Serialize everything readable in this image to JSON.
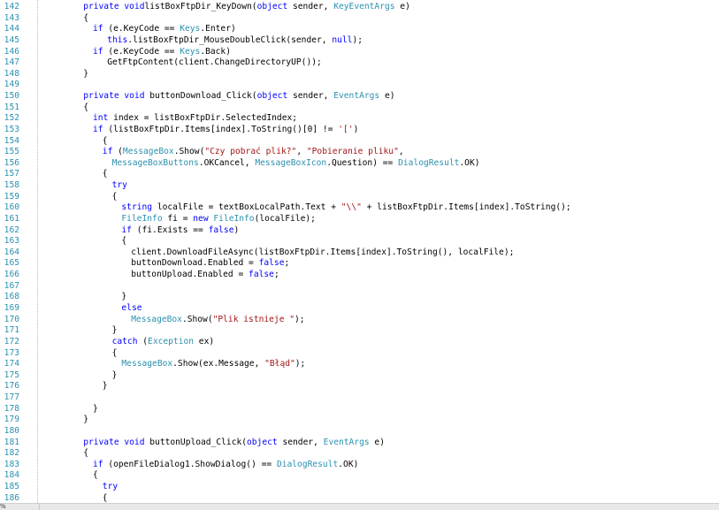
{
  "editor": {
    "lines": [
      {
        "n": "142",
        "indent": 8,
        "tokens": [
          [
            "kw",
            "private void"
          ],
          [
            "",
            "listBoxFtpDir_KeyDown("
          ],
          [
            "kw",
            "object"
          ],
          [
            "",
            " sender, "
          ],
          [
            "ty",
            "KeyEventArgs"
          ],
          [
            "",
            " e)"
          ]
        ]
      },
      {
        "n": "143",
        "indent": 8,
        "tokens": [
          [
            "",
            "{"
          ]
        ]
      },
      {
        "n": "144",
        "indent": 10,
        "tokens": [
          [
            "kw",
            "if"
          ],
          [
            "",
            " (e.KeyCode == "
          ],
          [
            "ty",
            "Keys"
          ],
          [
            "",
            ".Enter)"
          ]
        ]
      },
      {
        "n": "145",
        "indent": 13,
        "tokens": [
          [
            "kw",
            "this"
          ],
          [
            "",
            ".listBoxFtpDir_MouseDoubleClick(sender, "
          ],
          [
            "kw",
            "null"
          ],
          [
            "",
            ");"
          ]
        ]
      },
      {
        "n": "146",
        "indent": 10,
        "tokens": [
          [
            "kw",
            "if"
          ],
          [
            "",
            " (e.KeyCode == "
          ],
          [
            "ty",
            "Keys"
          ],
          [
            "",
            ".Back)"
          ]
        ]
      },
      {
        "n": "147",
        "indent": 13,
        "tokens": [
          [
            "",
            "GetFtpContent(client.ChangeDirectoryUP());"
          ]
        ]
      },
      {
        "n": "148",
        "indent": 8,
        "tokens": [
          [
            "",
            "}"
          ]
        ]
      },
      {
        "n": "149",
        "indent": 0,
        "tokens": []
      },
      {
        "n": "150",
        "indent": 8,
        "tokens": [
          [
            "kw",
            "private void"
          ],
          [
            "",
            " buttonDownload_Click("
          ],
          [
            "kw",
            "object"
          ],
          [
            "",
            " sender, "
          ],
          [
            "ty",
            "EventArgs"
          ],
          [
            "",
            " e)"
          ]
        ]
      },
      {
        "n": "151",
        "indent": 8,
        "tokens": [
          [
            "",
            "{"
          ]
        ]
      },
      {
        "n": "152",
        "indent": 10,
        "tokens": [
          [
            "kw",
            "int"
          ],
          [
            "",
            " index = listBoxFtpDir.SelectedIndex;"
          ]
        ]
      },
      {
        "n": "153",
        "indent": 10,
        "tokens": [
          [
            "kw",
            "if"
          ],
          [
            "",
            " (listBoxFtpDir.Items[index].ToString()[0] != "
          ],
          [
            "st",
            "'['"
          ],
          [
            "",
            ")"
          ]
        ]
      },
      {
        "n": "154",
        "indent": 12,
        "tokens": [
          [
            "",
            "{"
          ]
        ]
      },
      {
        "n": "155",
        "indent": 12,
        "tokens": [
          [
            "kw",
            "if"
          ],
          [
            "",
            " ("
          ],
          [
            "ty",
            "MessageBox"
          ],
          [
            "",
            ".Show("
          ],
          [
            "st",
            "\"Czy pobrać plik?\""
          ],
          [
            "",
            ", "
          ],
          [
            "st",
            "\"Pobieranie pliku\""
          ],
          [
            "",
            ","
          ]
        ]
      },
      {
        "n": "156",
        "indent": 14,
        "tokens": [
          [
            "ty",
            "MessageBoxButtons"
          ],
          [
            "",
            ".OKCancel, "
          ],
          [
            "ty",
            "MessageBoxIcon"
          ],
          [
            "",
            ".Question) == "
          ],
          [
            "ty",
            "DialogResult"
          ],
          [
            "",
            ".OK)"
          ]
        ]
      },
      {
        "n": "157",
        "indent": 12,
        "tokens": [
          [
            "",
            "{"
          ]
        ]
      },
      {
        "n": "158",
        "indent": 14,
        "tokens": [
          [
            "kw",
            "try"
          ]
        ]
      },
      {
        "n": "159",
        "indent": 14,
        "tokens": [
          [
            "",
            "{"
          ]
        ]
      },
      {
        "n": "160",
        "indent": 16,
        "tokens": [
          [
            "kw",
            "string"
          ],
          [
            "",
            " localFile = textBoxLocalPath.Text + "
          ],
          [
            "st",
            "\"\\\\\""
          ],
          [
            "",
            " + listBoxFtpDir.Items[index].ToString();"
          ]
        ]
      },
      {
        "n": "161",
        "indent": 16,
        "tokens": [
          [
            "ty",
            "FileInfo"
          ],
          [
            "",
            " fi = "
          ],
          [
            "kw",
            "new"
          ],
          [
            "",
            " "
          ],
          [
            "ty",
            "FileInfo"
          ],
          [
            "",
            "(localFile);"
          ]
        ]
      },
      {
        "n": "162",
        "indent": 16,
        "tokens": [
          [
            "kw",
            "if"
          ],
          [
            "",
            " (fi.Exists == "
          ],
          [
            "kw",
            "false"
          ],
          [
            "",
            ")"
          ]
        ]
      },
      {
        "n": "163",
        "indent": 16,
        "tokens": [
          [
            "",
            "{"
          ]
        ]
      },
      {
        "n": "164",
        "indent": 18,
        "tokens": [
          [
            "",
            "client.DownloadFileAsync(listBoxFtpDir.Items[index].ToString(), localFile);"
          ]
        ]
      },
      {
        "n": "165",
        "indent": 18,
        "tokens": [
          [
            "",
            "buttonDownload.Enabled = "
          ],
          [
            "kw",
            "false"
          ],
          [
            "",
            ";"
          ]
        ]
      },
      {
        "n": "166",
        "indent": 18,
        "tokens": [
          [
            "",
            "buttonUpload.Enabled = "
          ],
          [
            "kw",
            "false"
          ],
          [
            "",
            ";"
          ]
        ]
      },
      {
        "n": "167",
        "indent": 0,
        "tokens": []
      },
      {
        "n": "168",
        "indent": 16,
        "tokens": [
          [
            "",
            "}"
          ]
        ]
      },
      {
        "n": "169",
        "indent": 16,
        "tokens": [
          [
            "kw",
            "else"
          ]
        ]
      },
      {
        "n": "170",
        "indent": 18,
        "tokens": [
          [
            "ty",
            "MessageBox"
          ],
          [
            "",
            ".Show("
          ],
          [
            "st",
            "\"Plik istnieje \""
          ],
          [
            "",
            ");"
          ]
        ]
      },
      {
        "n": "171",
        "indent": 14,
        "tokens": [
          [
            "",
            "}"
          ]
        ]
      },
      {
        "n": "172",
        "indent": 14,
        "tokens": [
          [
            "kw",
            "catch"
          ],
          [
            "",
            " ("
          ],
          [
            "ty",
            "Exception"
          ],
          [
            "",
            " ex)"
          ]
        ]
      },
      {
        "n": "173",
        "indent": 14,
        "tokens": [
          [
            "",
            "{"
          ]
        ]
      },
      {
        "n": "174",
        "indent": 16,
        "tokens": [
          [
            "ty",
            "MessageBox"
          ],
          [
            "",
            ".Show(ex.Message, "
          ],
          [
            "st",
            "\"Błąd\""
          ],
          [
            "",
            ");"
          ]
        ]
      },
      {
        "n": "175",
        "indent": 14,
        "tokens": [
          [
            "",
            "}"
          ]
        ]
      },
      {
        "n": "176",
        "indent": 12,
        "tokens": [
          [
            "",
            "}"
          ]
        ]
      },
      {
        "n": "177",
        "indent": 0,
        "tokens": []
      },
      {
        "n": "178",
        "indent": 10,
        "tokens": [
          [
            "",
            "}"
          ]
        ]
      },
      {
        "n": "179",
        "indent": 8,
        "tokens": [
          [
            "",
            "}"
          ]
        ]
      },
      {
        "n": "180",
        "indent": 0,
        "tokens": []
      },
      {
        "n": "181",
        "indent": 8,
        "tokens": [
          [
            "kw",
            "private void"
          ],
          [
            "",
            " buttonUpload_Click("
          ],
          [
            "kw",
            "object"
          ],
          [
            "",
            " sender, "
          ],
          [
            "ty",
            "EventArgs"
          ],
          [
            "",
            " e)"
          ]
        ]
      },
      {
        "n": "182",
        "indent": 8,
        "tokens": [
          [
            "",
            "{"
          ]
        ]
      },
      {
        "n": "183",
        "indent": 10,
        "tokens": [
          [
            "kw",
            "if"
          ],
          [
            "",
            " (openFileDialog1.ShowDialog() == "
          ],
          [
            "ty",
            "DialogResult"
          ],
          [
            "",
            ".OK)"
          ]
        ]
      },
      {
        "n": "184",
        "indent": 10,
        "tokens": [
          [
            "",
            "{"
          ]
        ]
      },
      {
        "n": "185",
        "indent": 12,
        "tokens": [
          [
            "kw",
            "try"
          ]
        ]
      },
      {
        "n": "186",
        "indent": 12,
        "tokens": [
          [
            "",
            "{"
          ]
        ]
      }
    ]
  },
  "statusbar": {
    "zoom": "%"
  },
  "colors": {
    "keyword": "#0000ff",
    "type": "#2b91af",
    "string": "#a31515",
    "line_number": "#2b91af",
    "text": "#000000"
  }
}
